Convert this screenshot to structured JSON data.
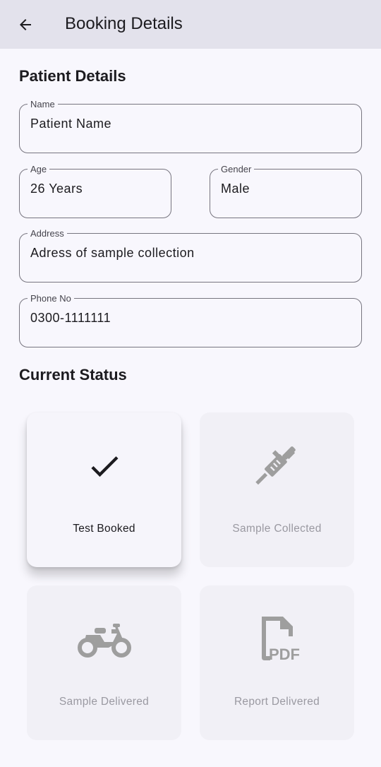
{
  "appbar": {
    "title": "Booking Details",
    "back_icon": "arrow-back-icon"
  },
  "patient": {
    "section_title": "Patient Details",
    "name": {
      "label": "Name",
      "value": "Patient Name"
    },
    "age": {
      "label": "Age",
      "value": "26 Years"
    },
    "gender": {
      "label": "Gender",
      "value": "Male"
    },
    "address": {
      "label": "Address",
      "value": "Adress of sample collection"
    },
    "phone": {
      "label": "Phone No",
      "value": "0300-1111111"
    }
  },
  "status": {
    "section_title": "Current Status",
    "steps": [
      {
        "label": "Test Booked",
        "icon": "check-icon",
        "state": "active"
      },
      {
        "label": "Sample Collected",
        "icon": "syringe-icon",
        "state": "inactive"
      },
      {
        "label": "Sample Delivered",
        "icon": "motorcycle-icon",
        "state": "inactive"
      },
      {
        "label": "Report Delivered",
        "icon": "pdf-file-icon",
        "state": "inactive"
      }
    ]
  },
  "colors": {
    "appbar_bg": "#e3e2ec",
    "page_bg": "#f8f7fd",
    "inactive_icon": "#9e9e9e",
    "active_icon": "#1c1b1f"
  }
}
